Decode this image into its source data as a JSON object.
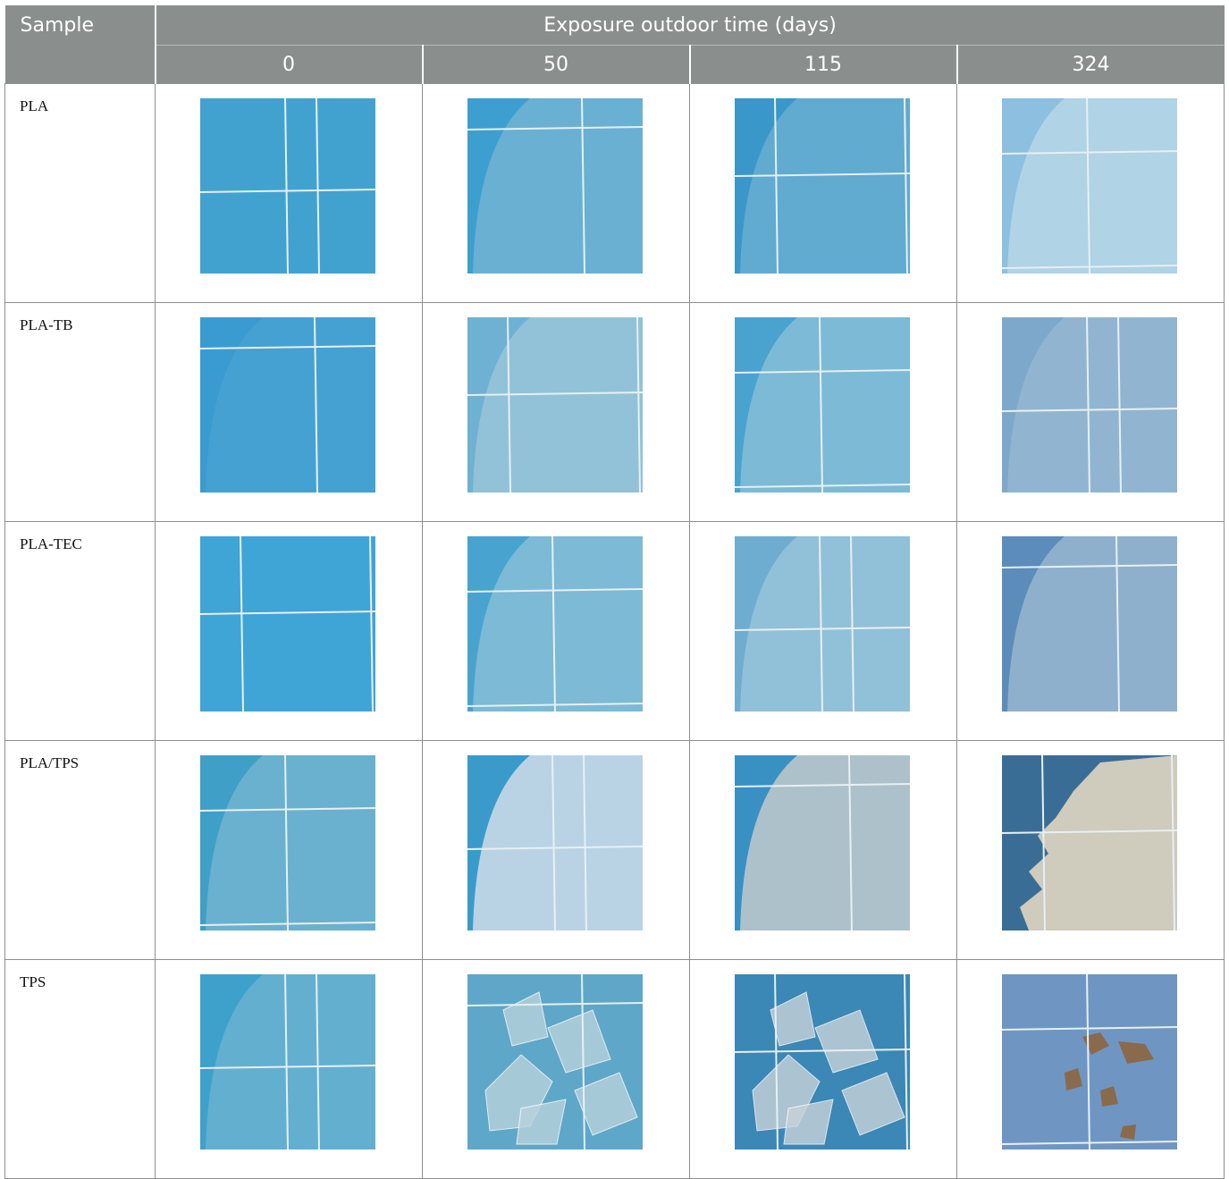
{
  "table": {
    "header": {
      "sample_label": "Sample",
      "group_label": "Exposure outdoor time (days)",
      "days": [
        "0",
        "50",
        "115",
        "324"
      ]
    },
    "rows": [
      {
        "sample": "PLA",
        "images": [
          {
            "day": "0",
            "bg": "#42a2cf",
            "film": "none",
            "film_color": "#5fb2d6"
          },
          {
            "day": "50",
            "bg": "#3c9fcf",
            "film": "arc",
            "film_color": "#79b6d4"
          },
          {
            "day": "115",
            "bg": "#3a97c9",
            "film": "arc",
            "film_color": "#6fb0d2"
          },
          {
            "day": "324",
            "bg": "#8cbfe0",
            "film": "arc",
            "film_color": "#bcd9e8"
          }
        ]
      },
      {
        "sample": "PLA-TB",
        "images": [
          {
            "day": "0",
            "bg": "#3a9bd0",
            "film": "arc",
            "film_color": "#4aa3d2"
          },
          {
            "day": "50",
            "bg": "#6fb1d2",
            "film": "arc",
            "film_color": "#9ec8da"
          },
          {
            "day": "115",
            "bg": "#4aa2cf",
            "film": "arc",
            "film_color": "#8ec1d8"
          },
          {
            "day": "324",
            "bg": "#7da8cc",
            "film": "arc",
            "film_color": "#98bad2"
          }
        ]
      },
      {
        "sample": "PLA-TEC",
        "images": [
          {
            "day": "0",
            "bg": "#3fa4d6",
            "film": "none",
            "film_color": "#4aa9d8"
          },
          {
            "day": "50",
            "bg": "#48a3cf",
            "film": "arc",
            "film_color": "#8ec2d8"
          },
          {
            "day": "115",
            "bg": "#6eacd0",
            "film": "arc",
            "film_color": "#9ec7dc"
          },
          {
            "day": "324",
            "bg": "#5c8cba",
            "film": "arc",
            "film_color": "#a0bcd2"
          }
        ]
      },
      {
        "sample": "PLA/TPS",
        "images": [
          {
            "day": "0",
            "bg": "#3f9fc6",
            "film": "arc",
            "film_color": "#78b7d0"
          },
          {
            "day": "50",
            "bg": "#3a9bcb",
            "film": "arc",
            "film_color": "#e4e6ee"
          },
          {
            "day": "115",
            "bg": "#3990c2",
            "film": "arc",
            "film_color": "#d4d2cc"
          },
          {
            "day": "324",
            "bg": "#3a6d96",
            "film": "ragged",
            "film_color": "#cfcbbd"
          }
        ]
      },
      {
        "sample": "TPS",
        "images": [
          {
            "day": "0",
            "bg": "#3ea1cc",
            "film": "arc",
            "film_color": "#70b4d2"
          },
          {
            "day": "50",
            "bg": "#5ea7c9",
            "film": "shards",
            "film_color": "#b8d2dc"
          },
          {
            "day": "115",
            "bg": "#3b87b6",
            "film": "shards",
            "film_color": "#c9d3d8"
          },
          {
            "day": "324",
            "bg": "#6f96c2",
            "film": "flakes",
            "film_color": "#8a6a4c"
          }
        ]
      }
    ]
  }
}
